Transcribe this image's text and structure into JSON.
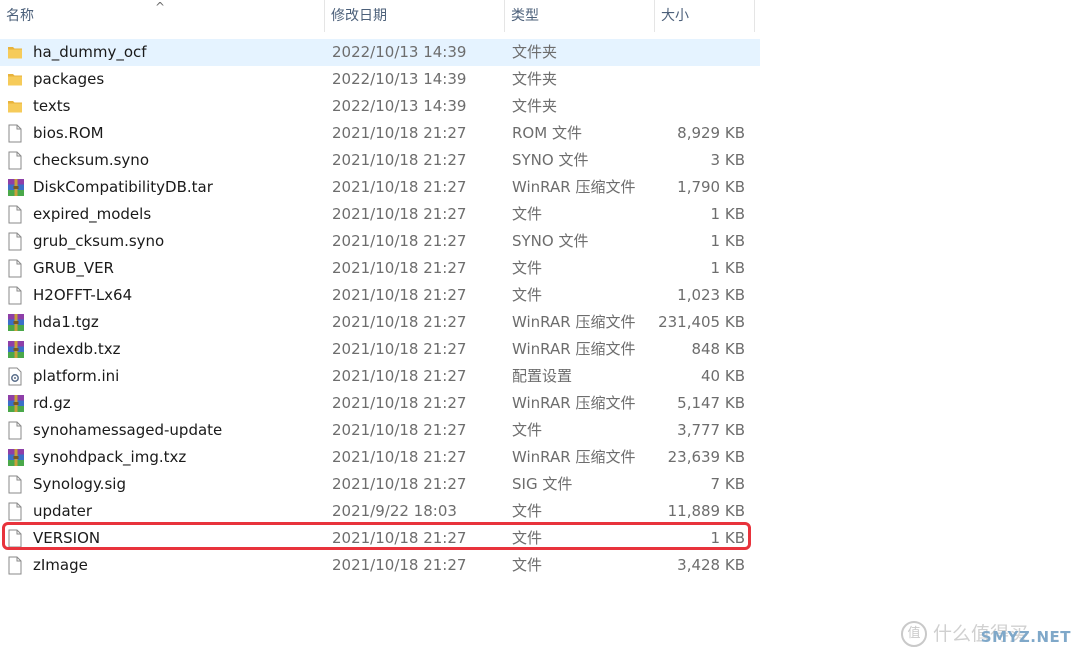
{
  "columns": {
    "name": "名称",
    "date": "修改日期",
    "type": "类型",
    "size": "大小"
  },
  "files": [
    {
      "name": "ha_dummy_ocf",
      "date": "2022/10/13 14:39",
      "type": "文件夹",
      "size": "",
      "icon": "folder-icon",
      "selected": true
    },
    {
      "name": "packages",
      "date": "2022/10/13 14:39",
      "type": "文件夹",
      "size": "",
      "icon": "folder-icon"
    },
    {
      "name": "texts",
      "date": "2022/10/13 14:39",
      "type": "文件夹",
      "size": "",
      "icon": "folder-icon"
    },
    {
      "name": "bios.ROM",
      "date": "2021/10/18 21:27",
      "type": "ROM 文件",
      "size": "8,929 KB",
      "icon": "file-icon"
    },
    {
      "name": "checksum.syno",
      "date": "2021/10/18 21:27",
      "type": "SYNO 文件",
      "size": "3 KB",
      "icon": "file-icon"
    },
    {
      "name": "DiskCompatibilityDB.tar",
      "date": "2021/10/18 21:27",
      "type": "WinRAR 压缩文件",
      "size": "1,790 KB",
      "icon": "winrar-icon"
    },
    {
      "name": "expired_models",
      "date": "2021/10/18 21:27",
      "type": "文件",
      "size": "1 KB",
      "icon": "file-icon"
    },
    {
      "name": "grub_cksum.syno",
      "date": "2021/10/18 21:27",
      "type": "SYNO 文件",
      "size": "1 KB",
      "icon": "file-icon"
    },
    {
      "name": "GRUB_VER",
      "date": "2021/10/18 21:27",
      "type": "文件",
      "size": "1 KB",
      "icon": "file-icon"
    },
    {
      "name": "H2OFFT-Lx64",
      "date": "2021/10/18 21:27",
      "type": "文件",
      "size": "1,023 KB",
      "icon": "file-icon"
    },
    {
      "name": "hda1.tgz",
      "date": "2021/10/18 21:27",
      "type": "WinRAR 压缩文件",
      "size": "231,405 KB",
      "icon": "winrar-icon"
    },
    {
      "name": "indexdb.txz",
      "date": "2021/10/18 21:27",
      "type": "WinRAR 压缩文件",
      "size": "848 KB",
      "icon": "winrar-icon"
    },
    {
      "name": "platform.ini",
      "date": "2021/10/18 21:27",
      "type": "配置设置",
      "size": "40 KB",
      "icon": "settings-file-icon"
    },
    {
      "name": "rd.gz",
      "date": "2021/10/18 21:27",
      "type": "WinRAR 压缩文件",
      "size": "5,147 KB",
      "icon": "winrar-icon"
    },
    {
      "name": "synohamessaged-update",
      "date": "2021/10/18 21:27",
      "type": "文件",
      "size": "3,777 KB",
      "icon": "file-icon"
    },
    {
      "name": "synohdpack_img.txz",
      "date": "2021/10/18 21:27",
      "type": "WinRAR 压缩文件",
      "size": "23,639 KB",
      "icon": "winrar-icon"
    },
    {
      "name": "Synology.sig",
      "date": "2021/10/18 21:27",
      "type": "SIG 文件",
      "size": "7 KB",
      "icon": "file-icon"
    },
    {
      "name": "updater",
      "date": "2021/9/22 18:03",
      "type": "文件",
      "size": "11,889 KB",
      "icon": "file-icon"
    },
    {
      "name": "VERSION",
      "date": "2021/10/18 21:27",
      "type": "文件",
      "size": "1 KB",
      "icon": "file-icon",
      "highlighted": true
    },
    {
      "name": "zImage",
      "date": "2021/10/18 21:27",
      "type": "文件",
      "size": "3,428 KB",
      "icon": "file-icon"
    }
  ],
  "watermark": {
    "logo": "值",
    "text_cn": "什么值得买",
    "text_en": "SMYZ.NET"
  },
  "colors": {
    "selected_row": "#e5f3ff",
    "highlight_box": "#e8333c",
    "folder": "#f2c14e"
  }
}
